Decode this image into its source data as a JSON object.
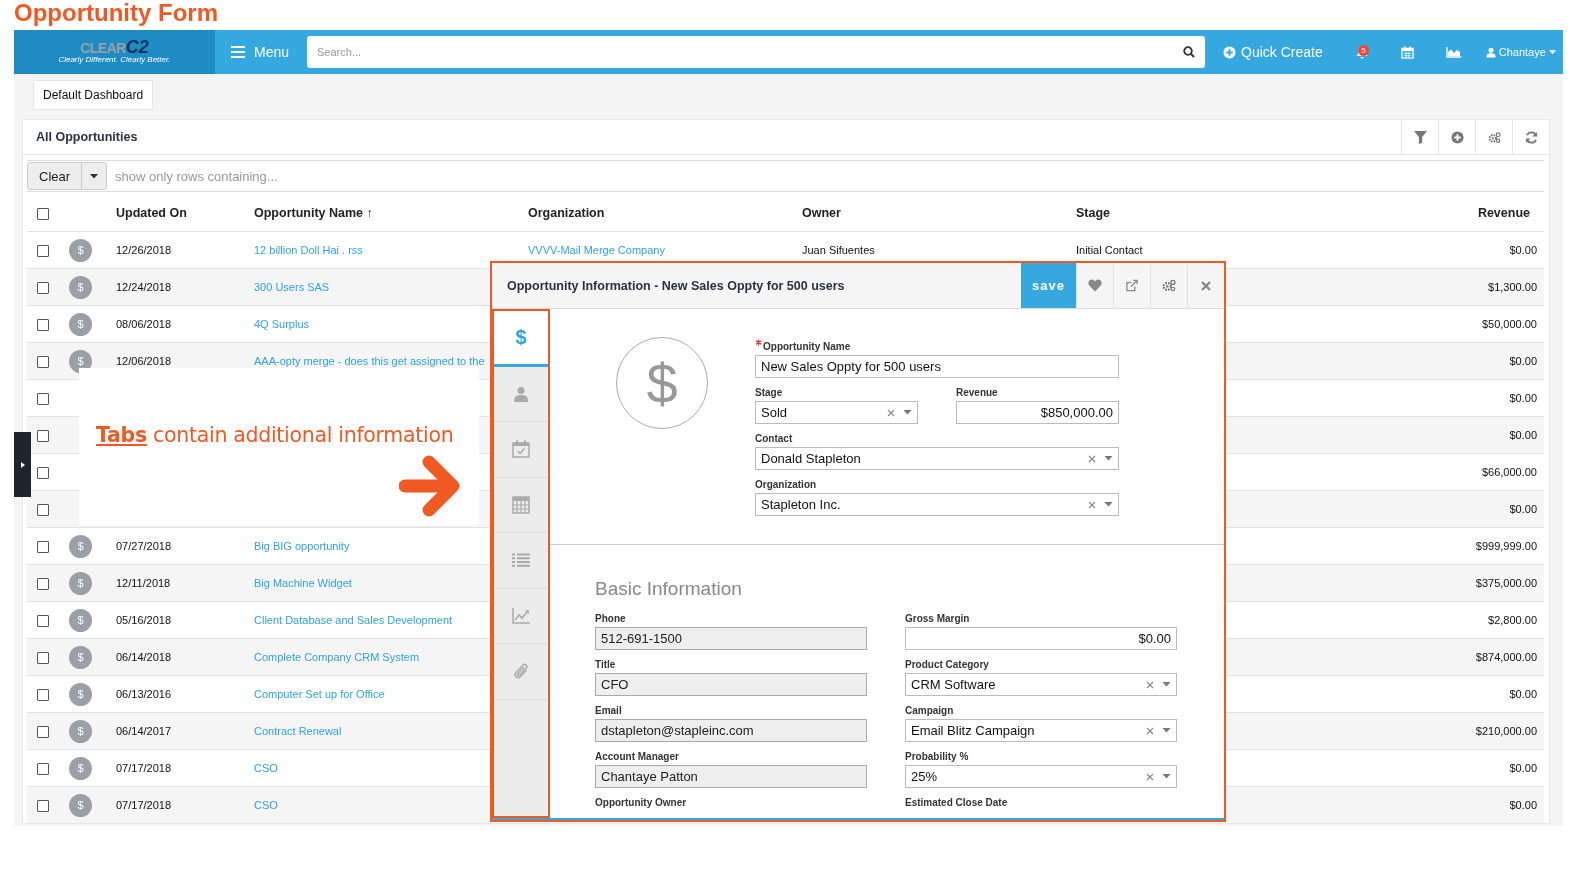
{
  "annotation": {
    "title": "Opportunity Form",
    "callout": "**Tabs** contain additional information"
  },
  "navbar": {
    "logo": {
      "name": "CLEAR",
      "mark": "C2",
      "tagline": "Clearly Different. Clearly Better."
    },
    "menu": "Menu",
    "search": {
      "placeholder": "Search..."
    },
    "quick_create": "Quick Create",
    "notifications": "5",
    "user": "Chantaye"
  },
  "dashboard_button": "Default Dashboard",
  "list": {
    "title": "All Opportunities",
    "filter": {
      "button": "Clear",
      "placeholder": "show only rows containing..."
    },
    "select_all": {
      "checked": false
    },
    "columns": [
      "Updated On",
      "Opportunity Name ↑",
      "Organization",
      "Owner",
      "Stage",
      "Revenue"
    ],
    "rows": [
      {
        "checked": false,
        "icon": "$",
        "updated_on": "12/26/2018",
        "name": "12 billion Doll Hai . rss",
        "organization": "VVVV-Mail Merge Company",
        "owner": "Juan Sifuentes",
        "stage": "Initial Contact",
        "revenue": "$0.00"
      },
      {
        "checked": false,
        "icon": "$",
        "updated_on": "12/24/2018",
        "name": "300 Users SAS",
        "revenue": "$1,300.00"
      },
      {
        "checked": false,
        "icon": "$",
        "updated_on": "08/06/2018",
        "name": "4Q Surplus",
        "revenue": "$50,000.00"
      },
      {
        "checked": false,
        "icon": "$",
        "updated_on": "12/06/2018",
        "name": "AAA-opty merge - does this get assigned to the",
        "revenue": "$0.00"
      },
      {
        "checked": false,
        "revenue": "$0.00"
      },
      {
        "checked": false,
        "revenue": "$0.00"
      },
      {
        "checked": false,
        "revenue": "$66,000.00"
      },
      {
        "checked": false,
        "revenue": "$0.00"
      },
      {
        "checked": false,
        "icon": "$",
        "updated_on": "07/27/2018",
        "name": "Big BIG opportunity",
        "revenue": "$999,999.00"
      },
      {
        "checked": false,
        "icon": "$",
        "updated_on": "12/11/2018",
        "name": "Big Machine Widget",
        "revenue": "$375,000.00"
      },
      {
        "checked": false,
        "icon": "$",
        "updated_on": "05/16/2018",
        "name": "Client Database and Sales Development",
        "revenue": "$2,800.00"
      },
      {
        "checked": false,
        "icon": "$",
        "updated_on": "06/14/2018",
        "name": "Complete Company CRM System",
        "revenue": "$874,000.00"
      },
      {
        "checked": false,
        "icon": "$",
        "updated_on": "06/13/2016",
        "name": "Computer Set up for Office",
        "revenue": "$0.00"
      },
      {
        "checked": false,
        "icon": "$",
        "updated_on": "06/14/2017",
        "name": "Contract Renewal",
        "revenue": "$210,000.00"
      },
      {
        "checked": false,
        "icon": "$",
        "updated_on": "07/17/2018",
        "name": "CSO",
        "revenue": "$0.00"
      },
      {
        "checked": false,
        "icon": "$",
        "updated_on": "07/17/2018",
        "name": "CSO",
        "revenue": "$0.00"
      }
    ]
  },
  "modal": {
    "title": "Opportunity Information - New Sales Oppty for 500 users",
    "save": "save",
    "tabs": [
      {
        "kind": "dollar",
        "label": "$",
        "selected": true
      },
      {
        "kind": "person",
        "selected": false
      },
      {
        "kind": "calendar",
        "selected": false
      },
      {
        "kind": "calculator",
        "selected": false
      },
      {
        "kind": "list",
        "selected": false
      },
      {
        "kind": "chart",
        "selected": false
      },
      {
        "kind": "paperclip",
        "selected": false
      }
    ],
    "avatar": "$",
    "fields": [
      {
        "kind": "text",
        "wide": true,
        "required": true,
        "label": "Opportunity Name",
        "value": "New Sales Oppty for 500 users"
      },
      {
        "kind": "select",
        "wide": false,
        "label": "Stage",
        "value": "Sold"
      },
      {
        "kind": "money",
        "wide": false,
        "label": "Revenue",
        "value": "$850,000.00"
      },
      {
        "kind": "select",
        "wide": true,
        "label": "Contact",
        "value": "Donald Stapleton"
      },
      {
        "kind": "select",
        "wide": true,
        "label": "Organization",
        "value": "Stapleton Inc."
      }
    ],
    "section": {
      "heading": "Basic Information",
      "fields": [
        {
          "kind": "readonly",
          "label": "Phone",
          "value": "512-691-1500"
        },
        {
          "kind": "money",
          "label": "Gross Margin",
          "value": "$0.00"
        },
        {
          "kind": "readonly",
          "label": "Title",
          "value": "CFO"
        },
        {
          "kind": "select",
          "label": "Product Category",
          "value": "CRM Software"
        },
        {
          "kind": "readonly",
          "label": "Email",
          "value": "dstapleton@stapleinc.com"
        },
        {
          "kind": "select",
          "label": "Campaign",
          "value": "Email Blitz Campaign"
        },
        {
          "kind": "readonly",
          "label": "Account Manager",
          "value": "Chantaye Patton"
        },
        {
          "kind": "select",
          "label": "Probability %",
          "value": "25%"
        },
        {
          "kind": "cut",
          "label": "Opportunity Owner"
        },
        {
          "kind": "cut",
          "label": "Estimated Close Date"
        }
      ]
    }
  }
}
